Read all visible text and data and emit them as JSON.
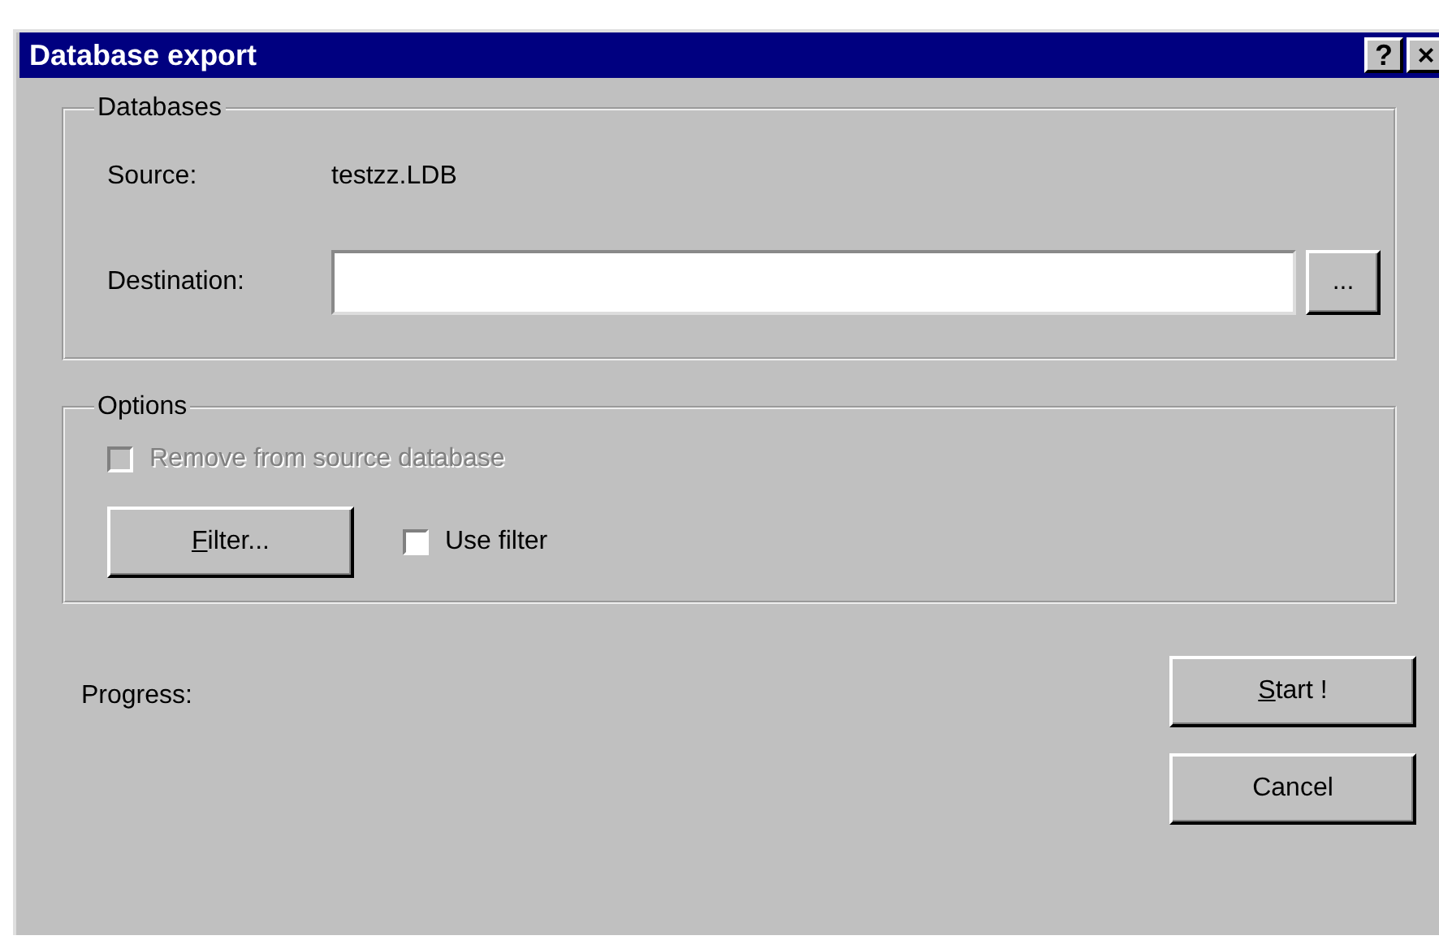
{
  "window": {
    "title": "Database export",
    "title_buttons": [
      "?",
      "×"
    ]
  },
  "databases": {
    "legend": "Databases",
    "source_label": "Source:",
    "source_value": "testzz.LDB",
    "destination_label": "Destination:",
    "browse": "..."
  },
  "options": {
    "legend": "Options",
    "checkboxes": [
      {
        "label": "Remove from source database",
        "checked": false,
        "disabled": true
      },
      {
        "label": "Use filter",
        "checked": false,
        "disabled": false
      }
    ],
    "filter_button": {
      "label": "Filter...",
      "mnemonic_first": true
    }
  },
  "progress_label": "Progress:",
  "buttons": [
    {
      "label": "Start !",
      "mnemonic_first": true
    },
    {
      "label": "Cancel",
      "mnemonic_first": false
    }
  ]
}
